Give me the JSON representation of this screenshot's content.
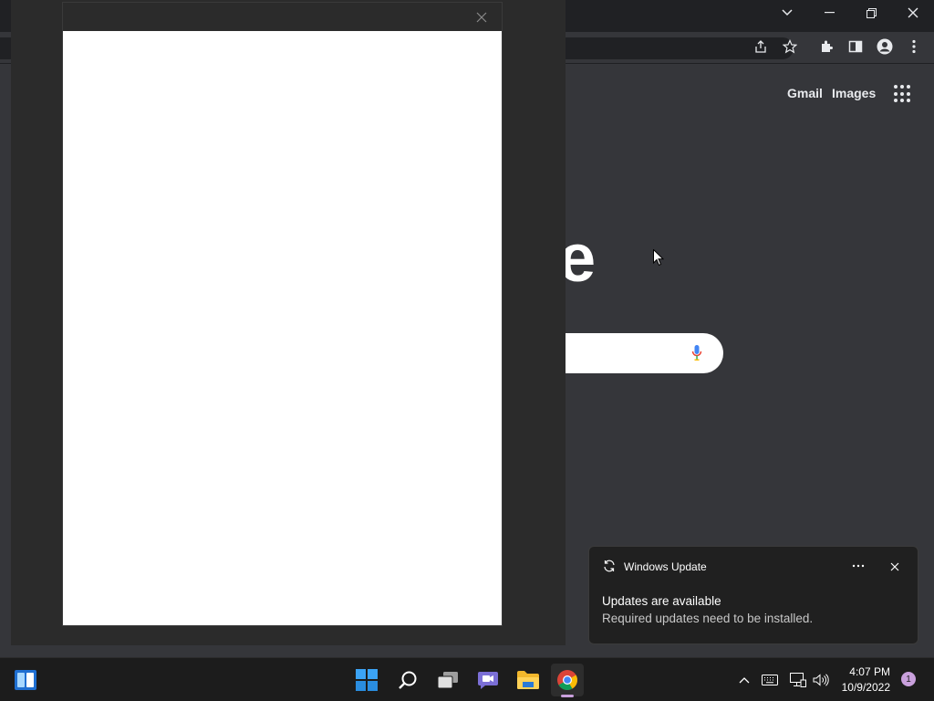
{
  "browser": {
    "toplinks": {
      "gmail": "Gmail",
      "images": "Images"
    },
    "logo_fragment": "e"
  },
  "toast": {
    "app": "Windows Update",
    "heading": "Updates are available",
    "body": "Required updates need to be installed."
  },
  "taskbar": {
    "time": "4:07 PM",
    "date": "10/9/2022",
    "notification_count": "1",
    "apps": [
      "widgets",
      "start",
      "search",
      "task-view",
      "teams-chat",
      "file-explorer",
      "chrome"
    ]
  },
  "colors": {
    "page_background": "#35363a",
    "dialog_content": "#ffffff",
    "taskbar": "#1c1c1c",
    "accent_badge": "#c9a0dc"
  }
}
